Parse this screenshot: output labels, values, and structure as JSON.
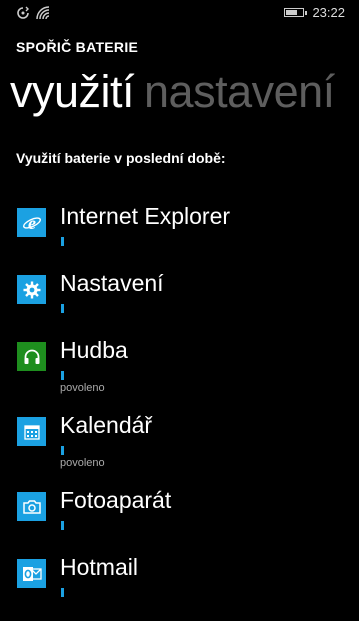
{
  "status_bar": {
    "time": "23:22",
    "icons": [
      "sync-icon",
      "wifi-icon",
      "battery-icon"
    ],
    "battery_level": 0.7
  },
  "header": {
    "app_title": "SPOŘIČ BATERIE"
  },
  "pivot": {
    "tabs": [
      {
        "label": "využití",
        "active": true
      },
      {
        "label": "nastavení",
        "active": false
      }
    ]
  },
  "section": {
    "heading": "Využití baterie v poslední době:"
  },
  "apps": [
    {
      "name": "Internet Explorer",
      "icon": "internet-explorer-icon",
      "status": "",
      "icon_bg": "#1ba1e2"
    },
    {
      "name": "Nastavení",
      "icon": "gear-icon",
      "status": "",
      "icon_bg": "#1ba1e2"
    },
    {
      "name": "Hudba",
      "icon": "headphones-icon",
      "status": "povoleno",
      "icon_bg": "#1e8e1e"
    },
    {
      "name": "Kalendář",
      "icon": "calendar-icon",
      "status": "povoleno",
      "icon_bg": "#1ba1e2"
    },
    {
      "name": "Fotoaparát",
      "icon": "camera-icon",
      "status": "",
      "icon_bg": "#1ba1e2"
    },
    {
      "name": "Hotmail",
      "icon": "outlook-icon",
      "status": "",
      "icon_bg": "#1ba1e2"
    }
  ],
  "colors": {
    "accent": "#1ba1e2",
    "background": "#000000",
    "inactive_tab": "#5e5e5e"
  }
}
